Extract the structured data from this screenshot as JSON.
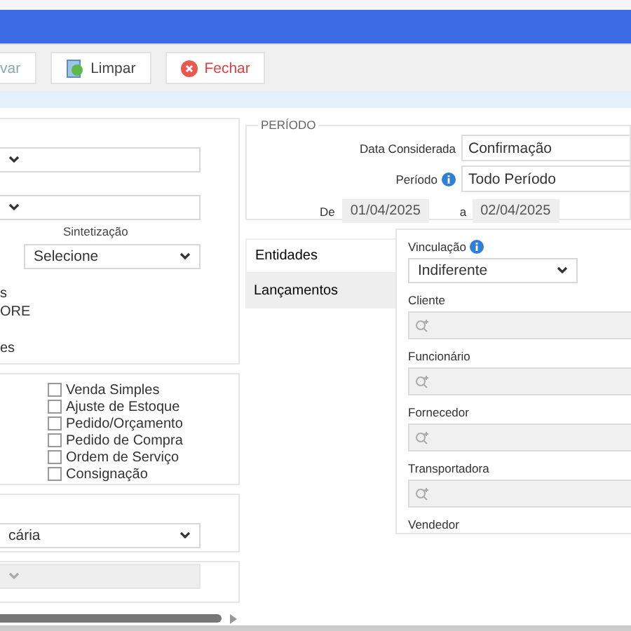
{
  "toolbar": {
    "buttons": [
      {
        "label": "var",
        "kind": "save"
      },
      {
        "label": "Limpar",
        "kind": "clear"
      },
      {
        "label": "Fechar",
        "kind": "close"
      }
    ]
  },
  "filters": {
    "selects": [
      {
        "kind": "select"
      },
      {
        "kind": "select"
      }
    ],
    "sintetizacao": {
      "label": "Sintetização",
      "value": "Selecione"
    },
    "option_fragments": [
      "s",
      "ORE",
      "es"
    ]
  },
  "document_types": [
    {
      "label": "Venda Simples",
      "checked": false
    },
    {
      "label": "Ajuste de Estoque",
      "checked": false
    },
    {
      "label": "Pedido/Orçamento",
      "checked": false
    },
    {
      "label": "Pedido de Compra",
      "checked": false
    },
    {
      "label": "Ordem de Serviço",
      "checked": false
    },
    {
      "label": "Consignação",
      "checked": false
    }
  ],
  "account_select": {
    "value": "cária"
  },
  "extra_select": {
    "disabled": true
  },
  "periodo": {
    "legend": "PERÍODO",
    "data_considerada": {
      "label": "Data Considerada",
      "value": "Confirmação"
    },
    "periodo": {
      "label": "Período",
      "value": "Todo Período"
    },
    "de": {
      "label": "De",
      "value": "01/04/2025"
    },
    "a": {
      "label": "a",
      "value": "02/04/2025"
    }
  },
  "tabs": [
    {
      "label": "Entidades",
      "selected": true
    },
    {
      "label": "Lançamentos",
      "selected": false
    }
  ],
  "vinculacao": {
    "label": "Vinculação",
    "value": "Indiferente"
  },
  "entity_fields": [
    {
      "label": "Cliente"
    },
    {
      "label": "Funcionário"
    },
    {
      "label": "Fornecedor"
    },
    {
      "label": "Transportadora"
    },
    {
      "label": "Vendedor"
    }
  ]
}
